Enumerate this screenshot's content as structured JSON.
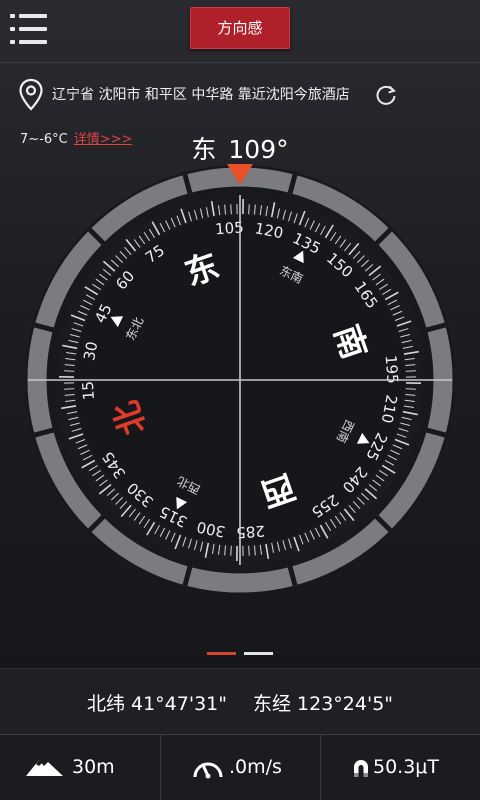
{
  "toolbar": {
    "menu_icon": "hamburger-menu-icon",
    "mode_button_label": "方向感",
    "mode_button_color": "#b0202a"
  },
  "location": {
    "icon": "location-pin-icon",
    "address": "辽宁省 沈阳市 和平区 中华路 靠近沈阳今旅酒店",
    "refresh_icon": "refresh-icon"
  },
  "weather": {
    "temperature": "7~-6°C",
    "details_link": "详情>>>",
    "link_color": "#e0453e"
  },
  "heading": {
    "direction": "东",
    "degrees": "109°"
  },
  "compass": {
    "heading_deg": 109,
    "cardinals": [
      {
        "label": "北",
        "angle": 0,
        "color": "#e03a2a"
      },
      {
        "label": "东",
        "angle": 90,
        "color": "#ffffff"
      },
      {
        "label": "南",
        "angle": 180,
        "color": "#ffffff"
      },
      {
        "label": "西",
        "angle": 270,
        "color": "#ffffff"
      }
    ],
    "intercardinals": [
      {
        "label": "东北",
        "angle": 45
      },
      {
        "label": "东南",
        "angle": 135
      },
      {
        "label": "西南",
        "angle": 225
      },
      {
        "label": "西北",
        "angle": 315
      }
    ],
    "degree_labels": [
      "15",
      "30",
      "45",
      "60",
      "75",
      "105",
      "120",
      "135",
      "150",
      "165",
      "195",
      "210",
      "225",
      "240",
      "255",
      "285",
      "300",
      "315",
      "330",
      "345"
    ],
    "pointer_color": "#e8502a"
  },
  "pager": {
    "active_index": 0,
    "count": 2,
    "active_color": "#d8452e",
    "inactive_color": "#e6e6e6"
  },
  "coordinates": {
    "latitude": "北纬 41°47'31\"",
    "longitude": "东经 123°24'5\""
  },
  "status": {
    "altitude": "30m",
    "altitude_icon": "mountain-icon",
    "speed": ".0m/s",
    "speed_icon": "speedometer-icon",
    "magnetic_field": "50.3μT",
    "magnetic_icon": "magnet-icon"
  }
}
